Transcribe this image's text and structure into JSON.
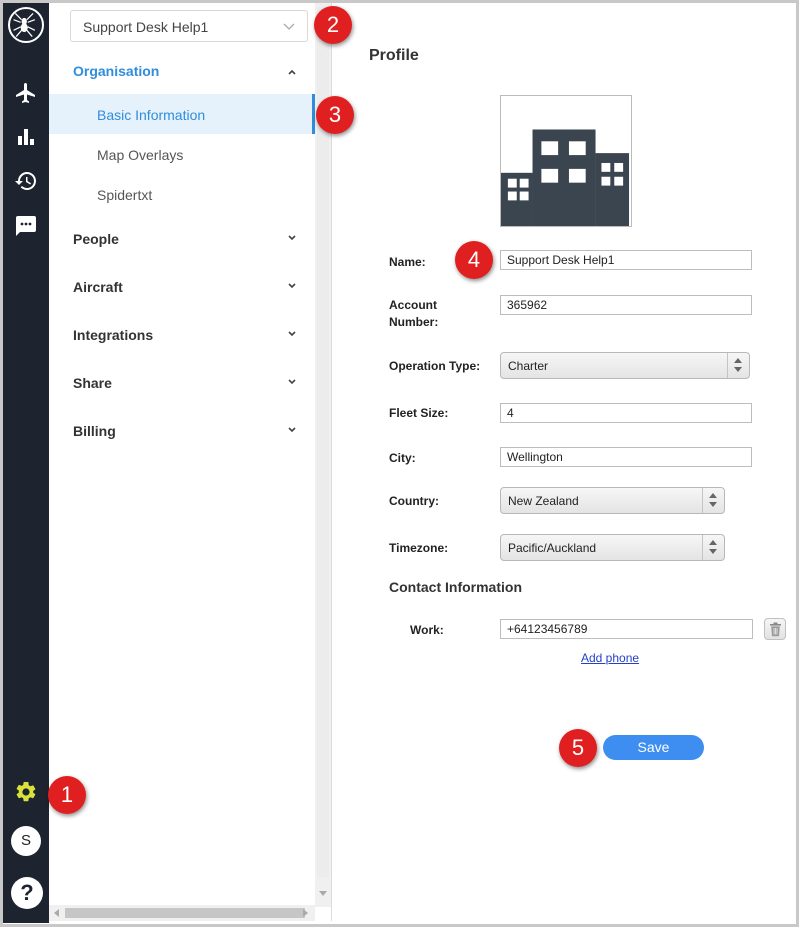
{
  "org_selector": {
    "value": "Support Desk Help1"
  },
  "nav": {
    "groups": [
      {
        "label": "Organisation",
        "expanded": true
      },
      {
        "label": "People"
      },
      {
        "label": "Aircraft"
      },
      {
        "label": "Integrations"
      },
      {
        "label": "Share"
      },
      {
        "label": "Billing"
      }
    ],
    "organisation_items": [
      "Basic Information",
      "Map Overlays",
      "Spidertxt"
    ],
    "active_item": "Basic Information"
  },
  "rail": {
    "icons": [
      "spider-logo-icon",
      "plane-icon",
      "bar-chart-icon",
      "history-icon",
      "chat-icon",
      "gear-icon"
    ],
    "avatar_letter": "S",
    "help_glyph": "?"
  },
  "profile": {
    "title": "Profile",
    "fields": {
      "name_label": "Name:",
      "name_value": "Support Desk Help1",
      "account_label": "Account Number:",
      "account_value": "365962",
      "operation_label": "Operation Type:",
      "operation_value": "Charter",
      "fleet_label": "Fleet Size:",
      "fleet_value": "4",
      "city_label": "City:",
      "city_value": "Wellington",
      "country_label": "Country:",
      "country_value": "New Zealand",
      "timezone_label": "Timezone:",
      "timezone_value": "Pacific/Auckland"
    },
    "contact": {
      "title": "Contact Information",
      "work_label": "Work:",
      "work_value": "+64123456789",
      "add_phone": "Add phone"
    },
    "save_label": "Save"
  },
  "annotations": [
    "1",
    "2",
    "3",
    "4",
    "5"
  ],
  "colors": {
    "rail_bg": "#1e2330",
    "accent": "#2f8ddb",
    "active_bg": "#e6f2fb",
    "gear": "#d8e23a",
    "save": "#3d8ef0",
    "badge": "#e02020"
  }
}
